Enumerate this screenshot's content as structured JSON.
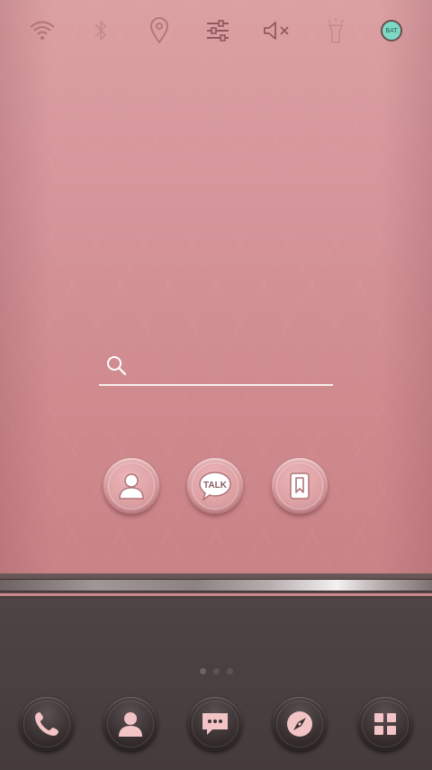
{
  "quick_settings": [
    {
      "name": "wifi-icon"
    },
    {
      "name": "bluetooth-icon"
    },
    {
      "name": "location-icon"
    },
    {
      "name": "settings-sliders-icon"
    },
    {
      "name": "volume-mute-icon"
    },
    {
      "name": "flashlight-icon"
    },
    {
      "name": "battery-icon",
      "label": "BAT"
    }
  ],
  "search": {
    "placeholder": "",
    "value": ""
  },
  "middle_apps": [
    {
      "name": "contacts-icon"
    },
    {
      "name": "talk-icon",
      "label": "TALK"
    },
    {
      "name": "bookmark-icon"
    }
  ],
  "page_indicator": {
    "pages": 3,
    "current": 1
  },
  "dock": [
    {
      "name": "phone-icon"
    },
    {
      "name": "contacts-icon"
    },
    {
      "name": "messages-icon"
    },
    {
      "name": "browser-compass-icon"
    },
    {
      "name": "app-drawer-icon"
    }
  ],
  "colors": {
    "wallpaper_pink": "#d5959a",
    "icon_pink": "#f2c4c6",
    "dock_brown": "#4a3f41",
    "battery_teal": "#7dd9c4"
  }
}
